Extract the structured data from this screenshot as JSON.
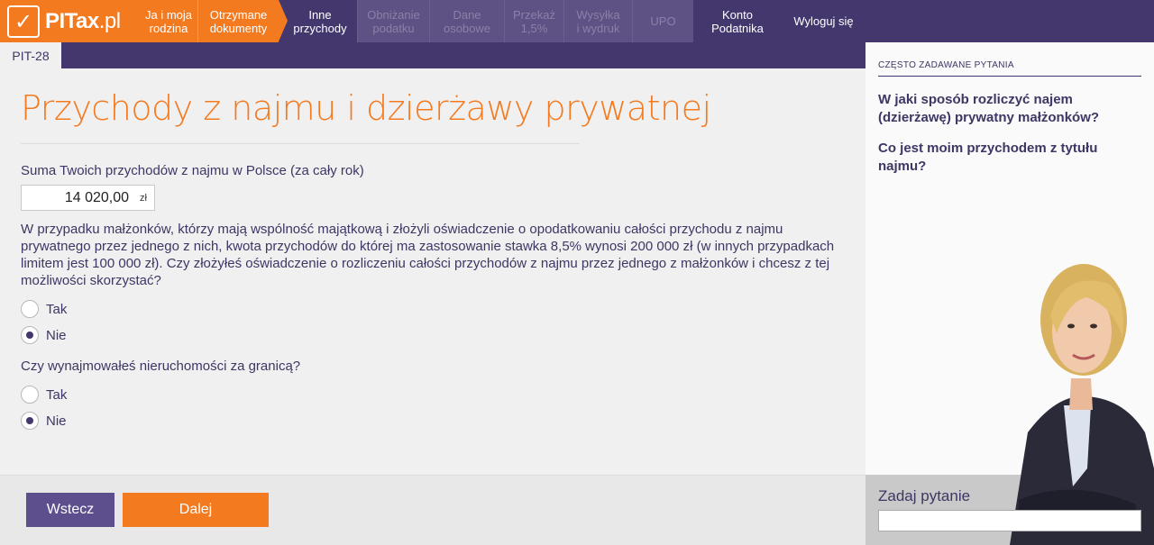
{
  "brand": {
    "logo_text": "PITax",
    "logo_suffix": ".pl",
    "logo_mark": "✓"
  },
  "nav": {
    "items": [
      {
        "label": "Ja i moja\nrodzina",
        "state": "done"
      },
      {
        "label": "Otrzymane\ndokumenty",
        "state": "done"
      },
      {
        "label": "Inne\nprzychody",
        "state": "active"
      },
      {
        "label": "Obniżanie\npodatku",
        "state": "disabled"
      },
      {
        "label": "Dane\nosobowe",
        "state": "disabled"
      },
      {
        "label": "Przekaż\n1,5%",
        "state": "disabled"
      },
      {
        "label": "Wysyłka\ni wydruk",
        "state": "disabled"
      },
      {
        "label": "UPO",
        "state": "disabled"
      }
    ],
    "account": "Konto\nPodatnika",
    "logout": "Wyloguj się"
  },
  "form_tab": "PIT-28",
  "main": {
    "title": "Przychody z najmu i dzierżawy prywatnej",
    "income_label": "Suma Twoich przychodów z najmu w Polsce (za cały rok)",
    "income_value": "14 020,00",
    "income_unit": "zł",
    "spouse_question": "W przypadku małżonków, którzy mają wspólność majątkową i złożyli oświadczenie o opodatkowaniu całości przychodu z najmu prywatnego przez jednego z nich, kwota przychodów do której ma zastosowanie stawka 8,5% wynosi 200 000 zł (w innych przypadkach limitem jest 100 000 zł). Czy złożyłeś oświadczenie o rozliczeniu całości przychodów z najmu przez jednego z małżonków i chcesz z tej możliwości skorzystać?",
    "q1_yes": "Tak",
    "q1_no": "Nie",
    "q1_selected": "Nie",
    "abroad_question": "Czy wynajmowałeś nieruchomości za granicą?",
    "q2_yes": "Tak",
    "q2_no": "Nie",
    "q2_selected": "Nie"
  },
  "footer": {
    "back": "Wstecz",
    "next": "Dalej"
  },
  "faq": {
    "heading": "CZĘSTO ZADAWANE PYTANIA",
    "questions": [
      "W jaki sposób rozliczyć najem (dzierżawę) prywatny małżonków?",
      "Co jest moim przychodem z tytułu najmu?"
    ]
  },
  "ask": {
    "label": "Zadaj pytanie",
    "placeholder": ""
  },
  "colors": {
    "orange": "#f47a20",
    "purple": "#43376e"
  }
}
